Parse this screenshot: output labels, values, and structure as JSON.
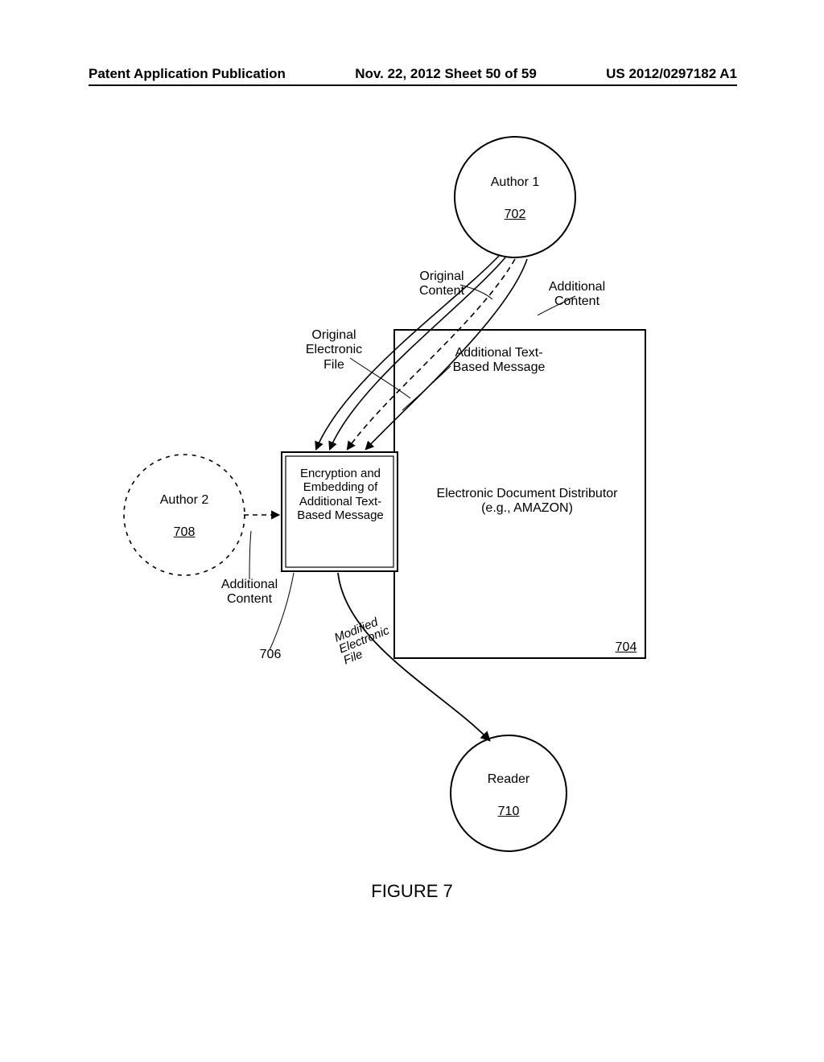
{
  "header": {
    "left": "Patent Application Publication",
    "center": "Nov. 22, 2012  Sheet 50 of 59",
    "right": "US 2012/0297182 A1"
  },
  "figure_caption": "FIGURE 7",
  "nodes": {
    "author1": {
      "label": "Author 1",
      "ref": "702"
    },
    "author2": {
      "label": "Author 2",
      "ref": "708"
    },
    "reader": {
      "label": "Reader",
      "ref": "710"
    },
    "encryption_box": "Encryption and Embedding of Additional Text-Based Message",
    "distributor": "Electronic Document Distributor (e.g., AMAZON)",
    "distributor_ref": "704",
    "ref_706": "706"
  },
  "arrow_labels": {
    "original_content": "Original Content",
    "additional_content_top": "Additional Content",
    "original_electronic_file": "Original Electronic File",
    "additional_text_msg": "Additional Text-Based Message",
    "additional_content_left": "Additional Content",
    "modified_file": "Modified Electronic File"
  }
}
